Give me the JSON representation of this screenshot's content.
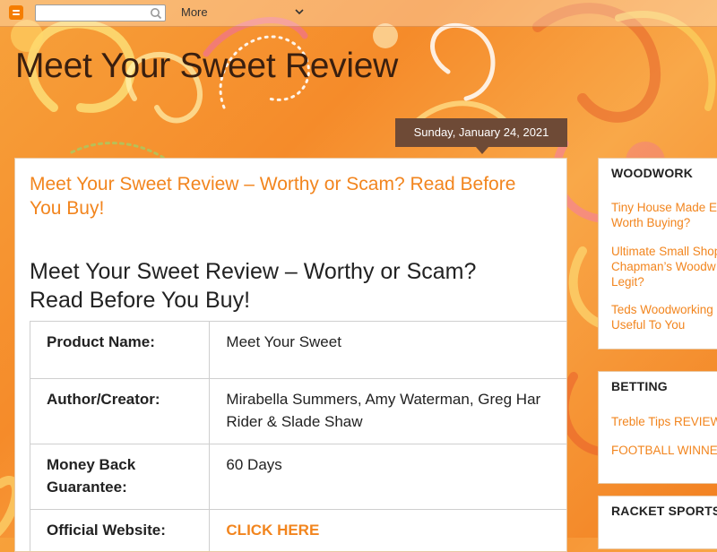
{
  "navbar": {
    "search_value": "",
    "more_label": "More"
  },
  "blog": {
    "title": "Meet Your Sweet Review"
  },
  "date_header": "Sunday, January 24, 2021",
  "post": {
    "title": "Meet Your Sweet Review – Worthy or Scam? Read Before You Buy!",
    "heading": "Meet Your Sweet Review – Worthy or Scam? Read Before You Buy!",
    "table": [
      {
        "label": "Product Name:",
        "value": "Meet Your Sweet"
      },
      {
        "label": "Author/Creator:",
        "value": "Mirabella Summers, Amy Waterman, Greg Har Rider & Slade Shaw"
      },
      {
        "label": "Money Back Guarantee:",
        "value": "60 Days"
      },
      {
        "label": "Official Website:",
        "value": "CLICK HERE"
      }
    ]
  },
  "sidebar": {
    "widgets": [
      {
        "title": "WOODWORK",
        "links": [
          "Tiny House Made E Worth Buying?",
          "Ultimate Small Shop Chapman’s Woodw Legit?",
          "Teds Woodworking Useful To You"
        ]
      },
      {
        "title": "BETTING",
        "links": [
          "Treble Tips REVIEW",
          "FOOTBALL WINNE"
        ]
      },
      {
        "title": "RACKET SPORTS",
        "links": []
      }
    ]
  },
  "colors": {
    "accent": "#f2851e",
    "date_bg": "#6e4a36",
    "title_text": "#3a1f0f"
  }
}
